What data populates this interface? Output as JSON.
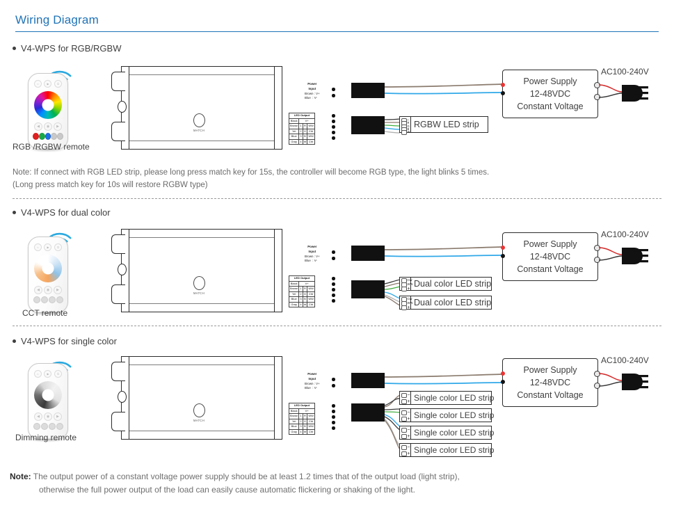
{
  "header": {
    "title": "Wiring Diagram"
  },
  "sections": [
    {
      "id": "rgb",
      "bullet": "V4-WPS for RGB/RGBW",
      "remote_label": "RGB /RGBW remote",
      "remote_type": "rgb",
      "remote_color_buttons": [
        "#e02020",
        "#1aa84a",
        "#1f6fe0",
        "#c9c9c9",
        "#c9c9c9"
      ],
      "remote_top_icons": [
        "⌂",
        "▶",
        "⏻"
      ],
      "remote_mid_icons": [
        "◀",
        "◉",
        "▶"
      ],
      "strips": [
        {
          "name": "RGBW LED strip",
          "terminals": [
            "+",
            "R",
            "G",
            "B",
            "W"
          ]
        }
      ]
    },
    {
      "id": "dual",
      "bullet": "V4-WPS for dual color",
      "remote_label": "CCT remote",
      "remote_type": "cct",
      "remote_color_buttons": [
        "#d8d8d8",
        "#d8d8d8",
        "#d8d8d8",
        "#d8d8d8"
      ],
      "remote_top_icons": [
        "⌂",
        "▶",
        "⏻"
      ],
      "remote_mid_icons": [
        "◀",
        "◉",
        "▶"
      ],
      "strips": [
        {
          "name": "Dual color LED strip",
          "terminals": [
            "CW",
            "WW",
            "+"
          ]
        },
        {
          "name": "Dual color LED strip",
          "terminals": [
            "CW",
            "WW",
            "+"
          ]
        }
      ]
    },
    {
      "id": "single",
      "bullet": "V4-WPS for single color",
      "remote_label": "Dimming remote",
      "remote_type": "dim",
      "remote_color_buttons": [
        "#d8d8d8",
        "#d8d8d8",
        "#d8d8d8",
        "#d8d8d8"
      ],
      "remote_top_icons": [
        "⌂",
        "▶",
        "⏻"
      ],
      "remote_mid_icons": [
        "◀",
        "◉",
        "▶"
      ],
      "strips": [
        {
          "name": "Single color LED strip",
          "terminals": [
            "−",
            "+"
          ]
        },
        {
          "name": "Single color LED strip",
          "terminals": [
            "−",
            "+"
          ]
        },
        {
          "name": "Single color LED strip",
          "terminals": [
            "−",
            "+"
          ]
        },
        {
          "name": "Single color LED strip",
          "terminals": [
            "−",
            "+"
          ]
        }
      ]
    }
  ],
  "controller": {
    "match_label": "MATCH",
    "power_input": {
      "title": "Power Input",
      "rows": [
        {
          "wire": "Brown",
          "sep": ":",
          "pin": "V+"
        },
        {
          "wire": "Blue",
          "sep": ":",
          "pin": "V-"
        }
      ]
    },
    "led_output": {
      "title": "LED Output",
      "vplus_row": {
        "wire": "Black",
        "value": "V+"
      },
      "rows": [
        {
          "wire": "Brown",
          "num": "1",
          "rgb": "R",
          "cct": "WW"
        },
        {
          "wire": "Yel",
          "num": "2",
          "rgb": "G",
          "cct": "CW"
        },
        {
          "wire": "Blue",
          "num": "3",
          "rgb": "B",
          "cct": "WW"
        },
        {
          "wire": "Gray",
          "num": "4",
          "rgb": "W",
          "cct": "CW"
        }
      ]
    }
  },
  "power_supply": {
    "line1": "Power Supply",
    "line2": "12-48VDC",
    "line3": "Constant Voltage",
    "ac_label": "AC100-240V"
  },
  "notes": {
    "rgb_note_line1": "Note: If connect with RGB LED strip, please long press match key for 15s, the controller will become RGB type, the light blinks 5 times.",
    "rgb_note_line2": "(Long press match key for 10s will restore RGBW type)",
    "bottom_label": "Note:",
    "bottom_line1": " The output power of a constant voltage power supply should be at least 1.2 times that of the output load (light strip),",
    "bottom_line2": "otherwise the full power output of the load can easily cause automatic flickering or shaking of the light."
  },
  "colors": {
    "title_blue": "#1f73b7",
    "wifi_blue": "#2aa9e0",
    "wire_brown": "#8a7a6d",
    "wire_blue": "#2fa8e8",
    "wire_black": "#3b3b3b",
    "wire_green": "#3fae3f",
    "wire_gray": "#b0b0b0",
    "wire_red": "#d42a2a"
  }
}
